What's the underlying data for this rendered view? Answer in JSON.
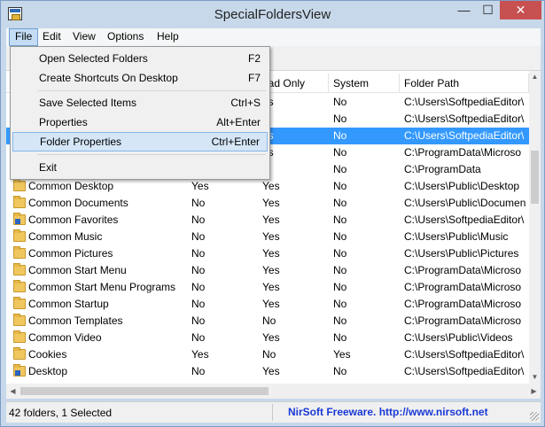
{
  "window": {
    "title": "SpecialFoldersView",
    "min_glyph": "—",
    "max_glyph": "☐",
    "close_glyph": "✕"
  },
  "menubar": [
    {
      "label": "File"
    },
    {
      "label": "Edit"
    },
    {
      "label": "View"
    },
    {
      "label": "Options"
    },
    {
      "label": "Help"
    }
  ],
  "file_menu": {
    "items": [
      {
        "label": "Open Selected Folders",
        "shortcut": "F2"
      },
      {
        "label": "Create Shortcuts On Desktop",
        "shortcut": "F7"
      },
      {
        "label": "Save Selected Items",
        "shortcut": "Ctrl+S"
      },
      {
        "label": "Properties",
        "shortcut": "Alt+Enter"
      },
      {
        "label": "Folder Properties",
        "shortcut": "Ctrl+Enter"
      },
      {
        "label": "Exit",
        "shortcut": ""
      }
    ]
  },
  "columns": [
    "",
    "",
    "ead Only",
    "System",
    "Folder Path"
  ],
  "rows": [
    {
      "name": "",
      "c2": "",
      "c3": "es",
      "c4": "No",
      "path": "C:\\Users\\SoftpediaEditor\\",
      "icon": "folder"
    },
    {
      "name": "",
      "c2": "",
      "c3": "o",
      "c4": "No",
      "path": "C:\\Users\\SoftpediaEditor\\",
      "icon": "folder"
    },
    {
      "name": "",
      "c2": "",
      "c3": "es",
      "c4": "No",
      "path": "C:\\Users\\SoftpediaEditor\\",
      "icon": "folder",
      "selected": true
    },
    {
      "name": "",
      "c2": "",
      "c3": "es",
      "c4": "No",
      "path": "C:\\ProgramData\\Microso",
      "icon": "folder"
    },
    {
      "name": "",
      "c2": "",
      "c3": "o",
      "c4": "No",
      "path": "C:\\ProgramData",
      "icon": "folder"
    },
    {
      "name": "Common Desktop",
      "c2": "Yes",
      "c3": "Yes",
      "c4": "No",
      "path": "C:\\Users\\Public\\Desktop",
      "icon": "folder"
    },
    {
      "name": "Common Documents",
      "c2": "No",
      "c3": "Yes",
      "c4": "No",
      "path": "C:\\Users\\Public\\Documen",
      "icon": "folder"
    },
    {
      "name": "Common Favorites",
      "c2": "No",
      "c3": "Yes",
      "c4": "No",
      "path": "C:\\Users\\SoftpediaEditor\\",
      "icon": "folder-special"
    },
    {
      "name": "Common Music",
      "c2": "No",
      "c3": "Yes",
      "c4": "No",
      "path": "C:\\Users\\Public\\Music",
      "icon": "folder"
    },
    {
      "name": "Common Pictures",
      "c2": "No",
      "c3": "Yes",
      "c4": "No",
      "path": "C:\\Users\\Public\\Pictures",
      "icon": "folder"
    },
    {
      "name": "Common Start Menu",
      "c2": "No",
      "c3": "Yes",
      "c4": "No",
      "path": "C:\\ProgramData\\Microso",
      "icon": "folder"
    },
    {
      "name": "Common Start Menu Programs",
      "c2": "No",
      "c3": "Yes",
      "c4": "No",
      "path": "C:\\ProgramData\\Microso",
      "icon": "folder"
    },
    {
      "name": "Common Startup",
      "c2": "No",
      "c3": "Yes",
      "c4": "No",
      "path": "C:\\ProgramData\\Microso",
      "icon": "folder"
    },
    {
      "name": "Common Templates",
      "c2": "No",
      "c3": "No",
      "c4": "No",
      "path": "C:\\ProgramData\\Microso",
      "icon": "folder"
    },
    {
      "name": "Common Video",
      "c2": "No",
      "c3": "Yes",
      "c4": "No",
      "path": "C:\\Users\\Public\\Videos",
      "icon": "folder"
    },
    {
      "name": "Cookies",
      "c2": "Yes",
      "c3": "No",
      "c4": "Yes",
      "path": "C:\\Users\\SoftpediaEditor\\",
      "icon": "folder"
    },
    {
      "name": "Desktop",
      "c2": "No",
      "c3": "Yes",
      "c4": "No",
      "path": "C:\\Users\\SoftpediaEditor\\",
      "icon": "folder-special"
    }
  ],
  "status": {
    "count": "42 folders, 1 Selected",
    "link": "NirSoft Freeware.  http://www.nirsoft.net"
  }
}
